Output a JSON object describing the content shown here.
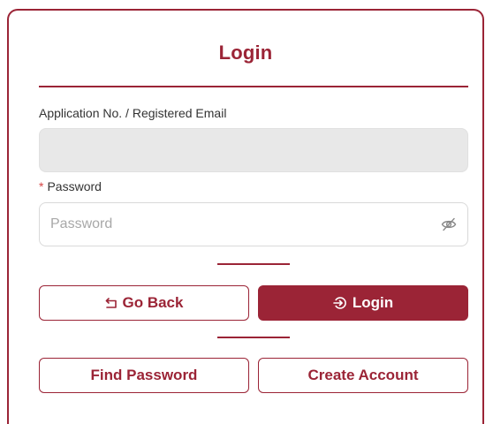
{
  "form": {
    "title": "Login",
    "email_label": "Application No. / Registered Email",
    "email_value": "",
    "password_required_marker": "*",
    "password_label": "Password",
    "password_placeholder": "Password",
    "password_value": "",
    "password_toggle_icon": "eye-off-icon"
  },
  "actions": {
    "go_back_label": "Go Back",
    "go_back_icon": "return-arrow-icon",
    "login_label": "Login",
    "login_icon": "login-arrow-icon",
    "find_password_label": "Find Password",
    "create_account_label": "Create Account"
  },
  "colors": {
    "accent": "#9b2436",
    "required": "#d64545",
    "disabled_input_bg": "#e8e8e8"
  }
}
